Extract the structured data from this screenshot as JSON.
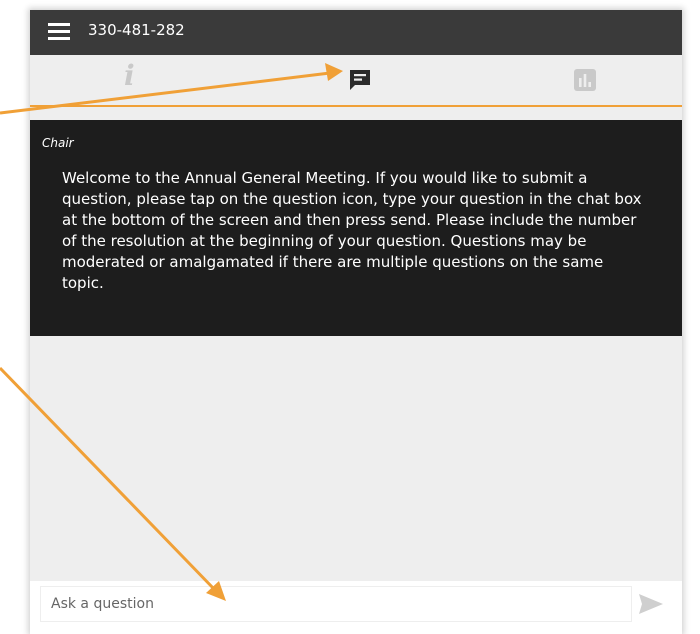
{
  "header": {
    "meeting_id": "330-481-282",
    "menu_icon": "hamburger-menu-icon"
  },
  "tabs": [
    {
      "icon": "info-icon",
      "glyph": "i",
      "active": false
    },
    {
      "icon": "chat-bubble-icon",
      "active": true
    },
    {
      "icon": "bar-chart-icon",
      "active": false
    }
  ],
  "message": {
    "sender": "Chair",
    "text": "Welcome to the Annual General Meeting. If you would like to submit a question, please tap on the question icon, type your question in the chat box at the bottom of the screen and then press send. Please include the number of the resolution at the beginning of your question. Questions may be moderated or amalgamated if there are multiple questions on the same topic."
  },
  "composer": {
    "placeholder": "Ask a question",
    "value": "",
    "send_icon": "send-icon"
  },
  "colors": {
    "header_bg": "#3a3a3a",
    "tabbar_bg": "#eeeeee",
    "accent": "#f0a037",
    "message_bg": "#1d1d1d",
    "inactive_icon": "#c9c9c9",
    "active_icon": "#2b2b2b",
    "annotation_arrow": "#f0a037"
  }
}
